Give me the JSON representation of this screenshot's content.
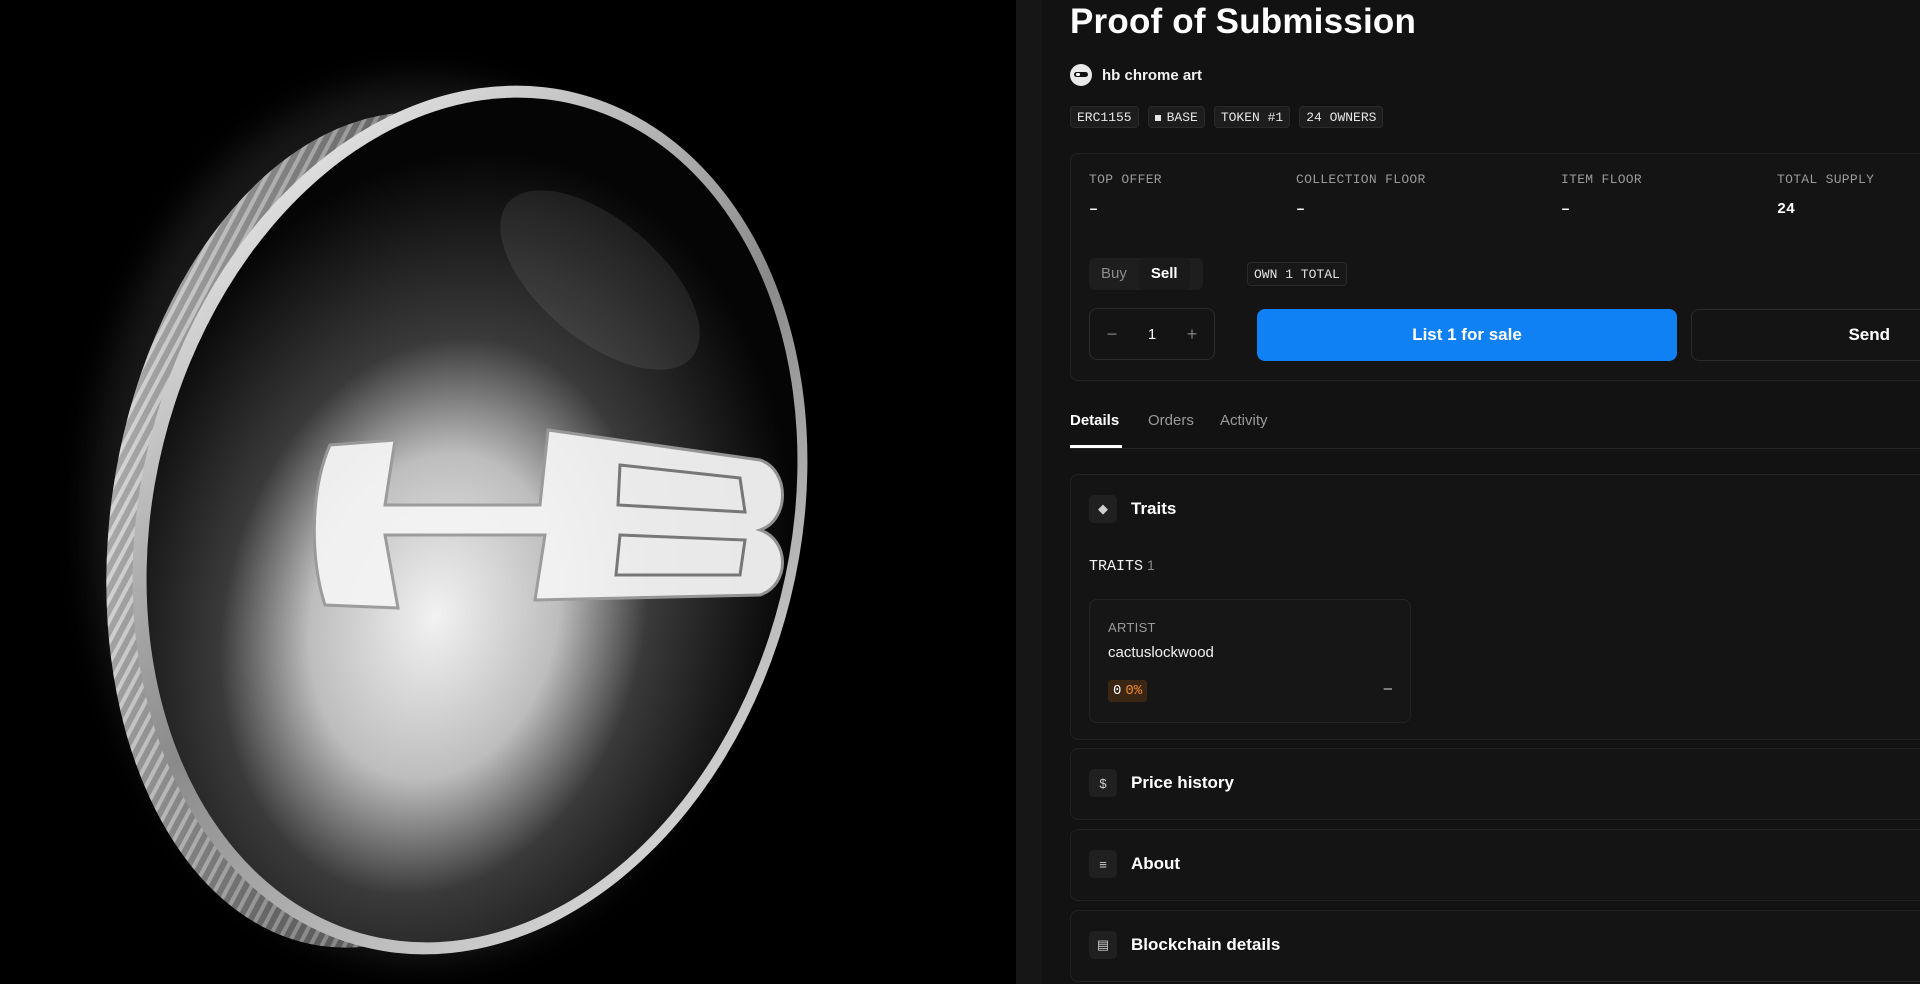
{
  "item": {
    "title": "Proof of Submission",
    "creator": "hb chrome art",
    "badges": [
      "ERC1155",
      "BASE",
      "TOKEN #1",
      "24 OWNERS"
    ]
  },
  "stats": [
    {
      "label": "TOP OFFER",
      "value": "–"
    },
    {
      "label": "COLLECTION FLOOR",
      "value": "–"
    },
    {
      "label": "ITEM FLOOR",
      "value": "–"
    },
    {
      "label": "TOTAL SUPPLY",
      "value": "24"
    }
  ],
  "trade": {
    "toggle": [
      "Buy",
      "Sell"
    ],
    "active": "Sell",
    "own_label": "OWN 1 TOTAL",
    "decrement": "−",
    "increment": "+",
    "quantity": "1",
    "list_label": "List 1 for sale",
    "send_label": "Send"
  },
  "tabs": [
    {
      "label": "Details",
      "active": true
    },
    {
      "label": "Orders",
      "active": false
    },
    {
      "label": "Activity",
      "active": false
    }
  ],
  "traits": {
    "title": "Traits",
    "icon": "diamond-icon",
    "section_label": "TRAITS",
    "count": "1",
    "items": [
      {
        "type": "ARTIST",
        "value": "cactuslockwood",
        "stat_count": "0",
        "stat_percent": "0%",
        "price": "–"
      }
    ]
  },
  "sections": [
    {
      "title": "Price history",
      "icon": "dollar-icon",
      "glyph": "$"
    },
    {
      "title": "About",
      "icon": "about-icon",
      "glyph": "≡"
    },
    {
      "title": "Blockchain details",
      "icon": "blockchain-icon",
      "glyph": "▤"
    }
  ],
  "colors": {
    "accent": "#1081f5",
    "background": "#121212",
    "trait_pill_bg": "#3b2614",
    "trait_pill_text": "#f08a2a"
  }
}
